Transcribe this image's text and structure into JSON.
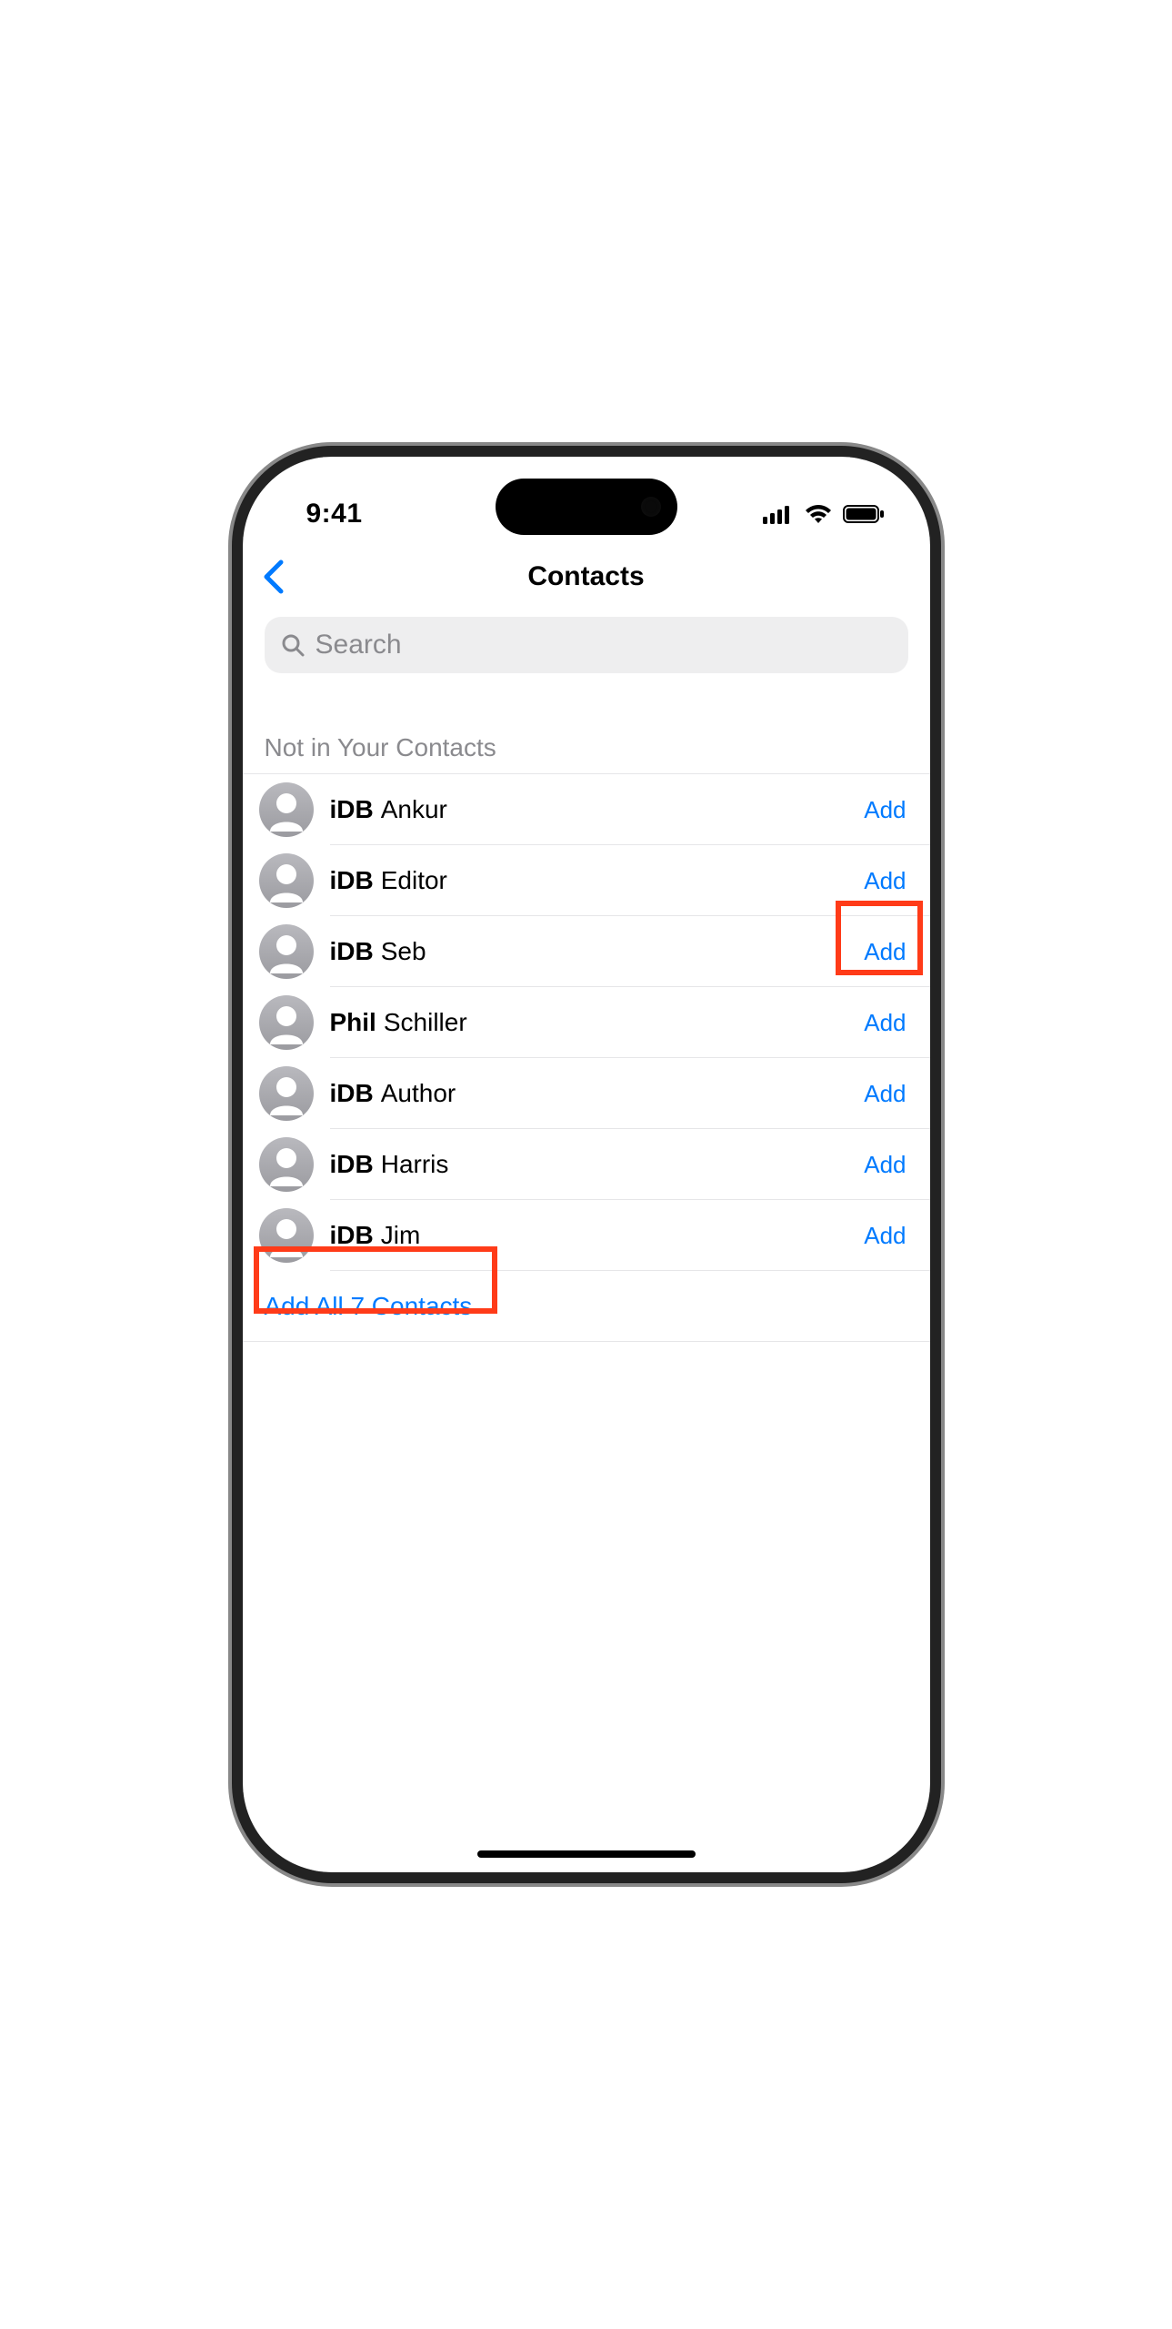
{
  "status": {
    "time": "9:41"
  },
  "nav": {
    "title": "Contacts"
  },
  "search": {
    "placeholder": "Search"
  },
  "section": {
    "header": "Not in Your Contacts"
  },
  "contacts": [
    {
      "bold": "iDB",
      "rest": "Ankur",
      "add": "Add"
    },
    {
      "bold": "iDB",
      "rest": "Editor",
      "add": "Add"
    },
    {
      "bold": "iDB",
      "rest": "Seb",
      "add": "Add"
    },
    {
      "bold": "Phil",
      "rest": "Schiller",
      "add": "Add"
    },
    {
      "bold": "iDB",
      "rest": "Author",
      "add": "Add"
    },
    {
      "bold": "iDB",
      "rest": "Harris",
      "add": "Add"
    },
    {
      "bold": "iDB",
      "rest": "Jim",
      "add": "Add"
    }
  ],
  "footer": {
    "add_all": "Add All 7 Contacts"
  },
  "colors": {
    "accent": "#007aff",
    "highlight": "#ff3b18"
  }
}
